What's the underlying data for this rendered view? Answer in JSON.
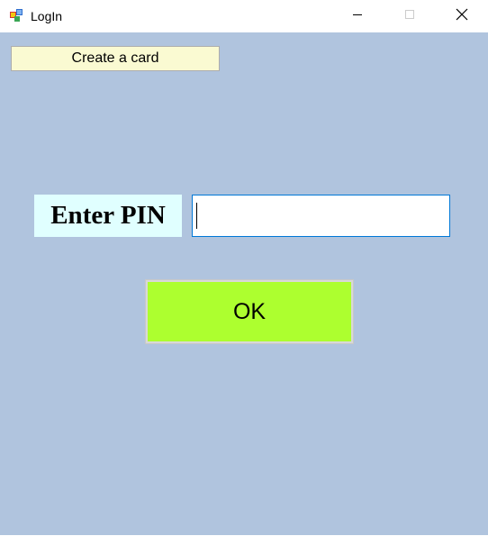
{
  "window": {
    "title": "LogIn",
    "app_icon": "winforms-app-icon",
    "controls": {
      "minimize_icon": "minimize-icon",
      "maximize_icon": "maximize-icon",
      "close_icon": "close-icon"
    }
  },
  "form": {
    "background_color": "#b0c4de",
    "create_card_label": "Create a card",
    "create_card_color": "#fafad2",
    "pin_label": "Enter PIN",
    "pin_label_color": "#e0ffff",
    "pin_value": "",
    "ok_label": "OK",
    "ok_color": "#adff2f"
  }
}
